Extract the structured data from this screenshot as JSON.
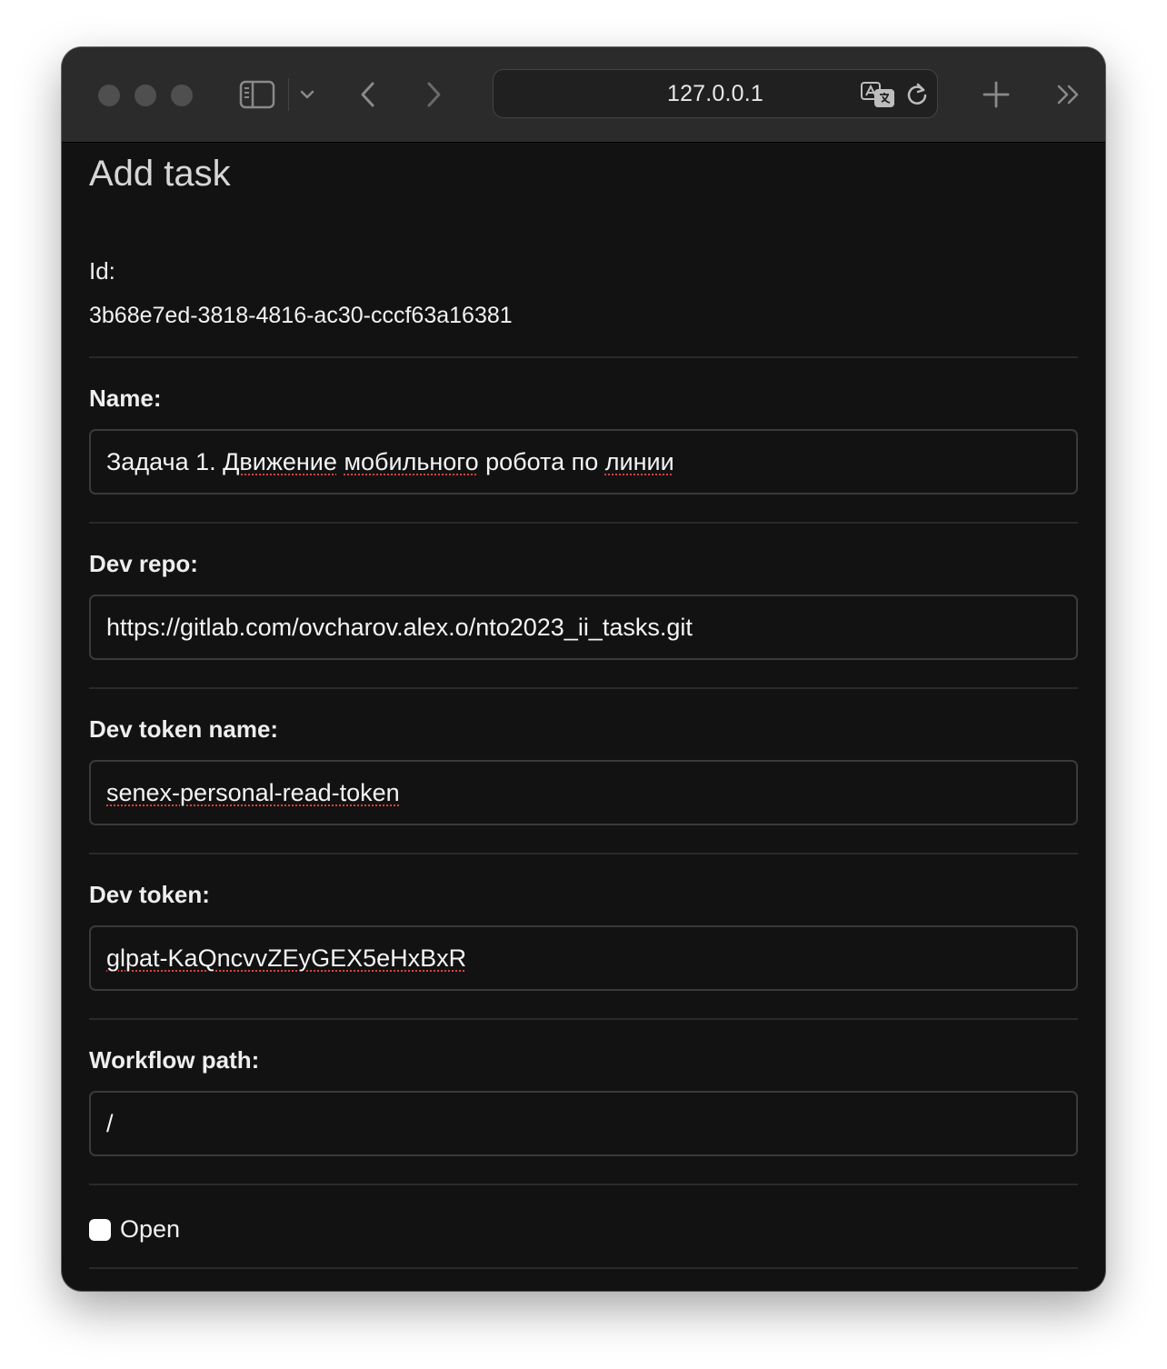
{
  "browser": {
    "address": "127.0.0.1"
  },
  "page": {
    "title": "Add task"
  },
  "form": {
    "id": {
      "label": "Id:",
      "value": "3b68e7ed-3818-4816-ac30-cccf63a16381"
    },
    "name": {
      "label": "Name:",
      "value_part1": "Задача 1. ",
      "value_word1": "Движение",
      "value_space1": " ",
      "value_word2": "мобильного",
      "value_part2": " робота по ",
      "value_word3": "линии"
    },
    "dev_repo": {
      "label": "Dev repo:",
      "value": "https://gitlab.com/ovcharov.alex.o/nto2023_ii_tasks.git"
    },
    "dev_token_name": {
      "label": "Dev token name:",
      "value": "senex-personal-read-token"
    },
    "dev_token": {
      "label": "Dev token:",
      "value": "glpat-KaQncvvZEyGEX5eHxBxR"
    },
    "workflow_path": {
      "label": "Workflow path:",
      "value": "/"
    },
    "open": {
      "label": "Open",
      "checked": false
    }
  },
  "colors": {
    "background": "#121212",
    "toolbar": "#2b2b2b",
    "spellcheck": "#e04040"
  }
}
